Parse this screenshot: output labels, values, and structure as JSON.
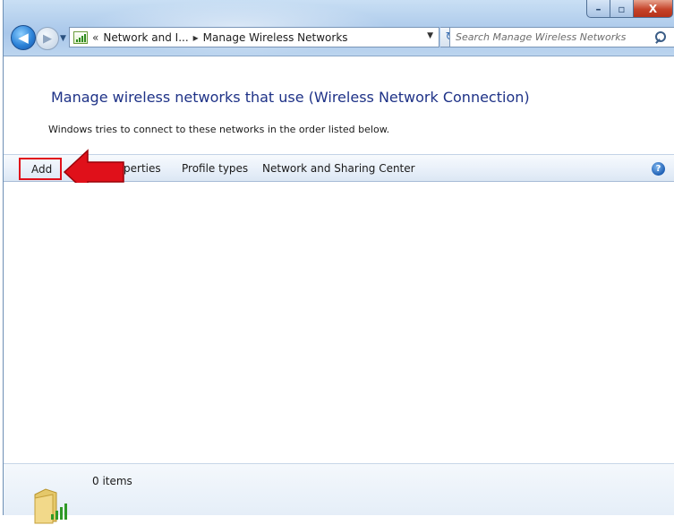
{
  "window": {
    "minimize_label": "–",
    "maximize_label": "▫",
    "close_label": "X"
  },
  "nav": {
    "back_glyph": "◀",
    "forward_glyph": "▶",
    "address": {
      "overflow": "«",
      "crumb1": "Network and I...",
      "separator": "▸",
      "crumb2": "Manage Wireless Networks"
    },
    "refresh_glyph": "↻",
    "search_placeholder": "Search Manage Wireless Networks"
  },
  "content": {
    "heading": "Manage wireless networks that use (Wireless Network Connection)",
    "description": "Windows tries to connect to these networks in the order listed below."
  },
  "toolbar": {
    "add": "Add",
    "properties": "roperties",
    "profile_types": "Profile types",
    "network_center": "Network and Sharing Center",
    "help": "?"
  },
  "status": {
    "items": "0 items"
  },
  "colors": {
    "heading": "#1e3287",
    "highlight": "#e0101a"
  }
}
